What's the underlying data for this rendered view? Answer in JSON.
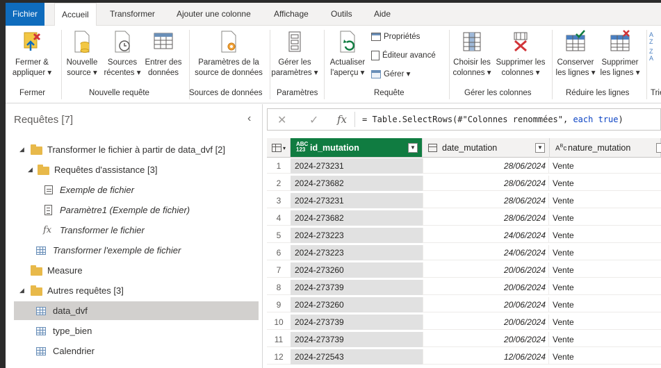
{
  "tabs": [
    "Fichier",
    "Accueil",
    "Transformer",
    "Ajouter une colonne",
    "Affichage",
    "Outils",
    "Aide"
  ],
  "ribbon": {
    "fermer": {
      "btn_line1": "Fermer &",
      "btn_line2": "appliquer",
      "group": "Fermer"
    },
    "nouvelle_requete": {
      "nouvelle_source_l1": "Nouvelle",
      "nouvelle_source_l2": "source",
      "sources_recentes_l1": "Sources",
      "sources_recentes_l2": "récentes",
      "entrer_donnees_l1": "Entrer des",
      "entrer_donnees_l2": "données",
      "group": "Nouvelle requête"
    },
    "sources": {
      "btn_line1": "Paramètres de la",
      "btn_line2": "source de données",
      "group": "Sources de données"
    },
    "parametres": {
      "btn_line1": "Gérer les",
      "btn_line2": "paramètres",
      "group": "Paramètres"
    },
    "requete": {
      "actualiser_l1": "Actualiser",
      "actualiser_l2": "l'aperçu",
      "proprietes": "Propriétés",
      "editeur": "Éditeur avancé",
      "gerer": "Gérer",
      "group": "Requête"
    },
    "colonnes": {
      "choisir_l1": "Choisir les",
      "choisir_l2": "colonnes",
      "supprimer_l1": "Supprimer les",
      "supprimer_l2": "colonnes",
      "group": "Gérer les colonnes"
    },
    "lignes": {
      "conserver_l1": "Conserver",
      "conserver_l2": "les lignes",
      "supprimer_l1": "Supprimer",
      "supprimer_l2": "les lignes",
      "group": "Réduire les lignes"
    },
    "trier": {
      "group": "Trie"
    }
  },
  "queries": {
    "title": "Requêtes [7]",
    "items": [
      {
        "label": "Transformer le fichier à partir de data_dvf [2]"
      },
      {
        "label": "Requêtes d'assistance [3]"
      },
      {
        "label": "Exemple de fichier"
      },
      {
        "label": "Paramètre1 (Exemple de fichier)"
      },
      {
        "label": "Transformer le fichier"
      },
      {
        "label": "Transformer l'exemple de fichier"
      },
      {
        "label": "Measure"
      },
      {
        "label": "Autres requêtes [3]"
      },
      {
        "label": "data_dvf"
      },
      {
        "label": "type_bien"
      },
      {
        "label": "Calendrier"
      }
    ]
  },
  "formula": {
    "prefix": "= Table.SelectRows(#",
    "string": "\"Colonnes renommées\"",
    "comma": ", ",
    "kw_each": "each",
    "kw_true": "true",
    "suffix": ")"
  },
  "grid": {
    "columns": [
      {
        "name": "id_mutation",
        "type_icon": "ABC 123"
      },
      {
        "name": "date_mutation",
        "type_icon": "calendar"
      },
      {
        "name": "nature_mutation",
        "type_icon": "ABC"
      }
    ],
    "rows": [
      {
        "n": "1",
        "id": "2024-273231",
        "date": "28/06/2024",
        "nature": "Vente"
      },
      {
        "n": "2",
        "id": "2024-273682",
        "date": "28/06/2024",
        "nature": "Vente"
      },
      {
        "n": "3",
        "id": "2024-273231",
        "date": "28/06/2024",
        "nature": "Vente"
      },
      {
        "n": "4",
        "id": "2024-273682",
        "date": "28/06/2024",
        "nature": "Vente"
      },
      {
        "n": "5",
        "id": "2024-273223",
        "date": "24/06/2024",
        "nature": "Vente"
      },
      {
        "n": "6",
        "id": "2024-273223",
        "date": "24/06/2024",
        "nature": "Vente"
      },
      {
        "n": "7",
        "id": "2024-273260",
        "date": "20/06/2024",
        "nature": "Vente"
      },
      {
        "n": "8",
        "id": "2024-273739",
        "date": "20/06/2024",
        "nature": "Vente"
      },
      {
        "n": "9",
        "id": "2024-273260",
        "date": "20/06/2024",
        "nature": "Vente"
      },
      {
        "n": "10",
        "id": "2024-273739",
        "date": "20/06/2024",
        "nature": "Vente"
      },
      {
        "n": "11",
        "id": "2024-273739",
        "date": "20/06/2024",
        "nature": "Vente"
      },
      {
        "n": "12",
        "id": "2024-272543",
        "date": "12/06/2024",
        "nature": "Vente"
      }
    ]
  },
  "colors": {
    "accent": "#0f6cbd",
    "selected_column": "#107c41",
    "folder": "#e8b94a"
  }
}
